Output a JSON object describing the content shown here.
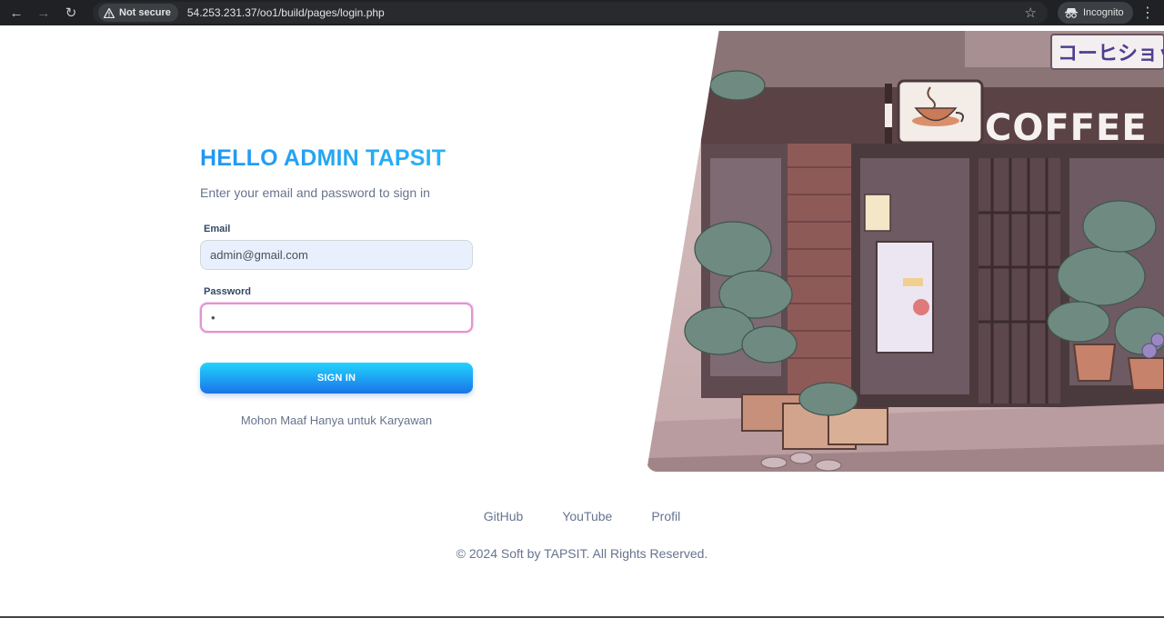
{
  "browser": {
    "security_label": "Not secure",
    "url": "54.253.231.37/oo1/build/pages/login.php",
    "incognito_label": "Incognito"
  },
  "login": {
    "title": "HELLO ADMIN TAPSIT",
    "subtitle": "Enter your email and password to sign in",
    "email_label": "Email",
    "email_value": "admin@gmail.com",
    "password_label": "Password",
    "password_value": "•",
    "signin_label": "SIGN IN",
    "note": "Mohon Maaf Hanya untuk Karyawan"
  },
  "hero": {
    "sign_text": "COFFEE",
    "banner_text": "コーヒショップ"
  },
  "footer": {
    "links": [
      "GitHub",
      "YouTube",
      "Profil"
    ],
    "copyright": "© 2024 Soft by TAPSIT. All Rights Reserved."
  },
  "colors": {
    "accent": "#1a73e8",
    "title": "#2196f3",
    "muted": "#67748e"
  }
}
